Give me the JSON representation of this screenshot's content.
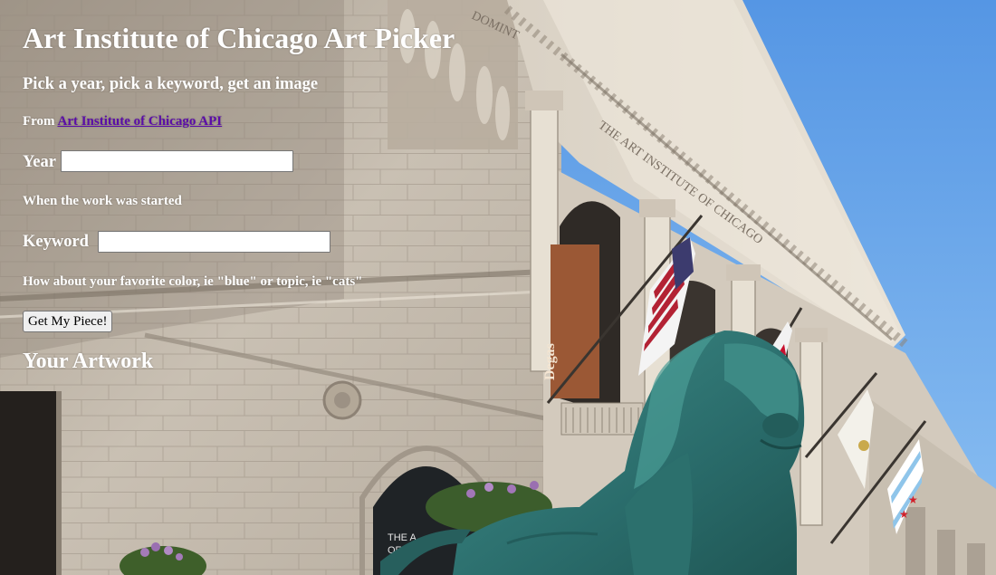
{
  "header": {
    "title": "Art Institute of Chicago Art Picker",
    "subtitle": "Pick a year, pick a keyword, get an image",
    "source_prefix": "From",
    "source_link": "Art Institute of Chicago API"
  },
  "form": {
    "year_label": "Year",
    "year_value": "",
    "year_hint": "When the work was started",
    "keyword_label": "Keyword",
    "keyword_value": "",
    "keyword_hint": "How about your favorite color, ie \"blue\" or topic, ie \"cats\"",
    "submit_label": "Get My Piece!"
  },
  "results": {
    "heading": "Your Artwork"
  },
  "background": {
    "banner_text": "Degas",
    "door_text_line1": "THE A",
    "door_text_line2": "OF  C",
    "frieze_text": "THE ART INSTITUTE OF CHICAGO",
    "frieze_text_top": "DOMINT"
  },
  "colors": {
    "sky": "#5d9fe6",
    "stone": "#cfc6b9",
    "lion": "#2f7a78",
    "link": "#5b0da8",
    "text": "#ffffff"
  },
  "icons": {
    "background": "art-institute-building-photo",
    "flag_us": "us-flag-icon",
    "flag_chicago": "chicago-flag-icon",
    "lion": "bronze-lion-statue"
  }
}
